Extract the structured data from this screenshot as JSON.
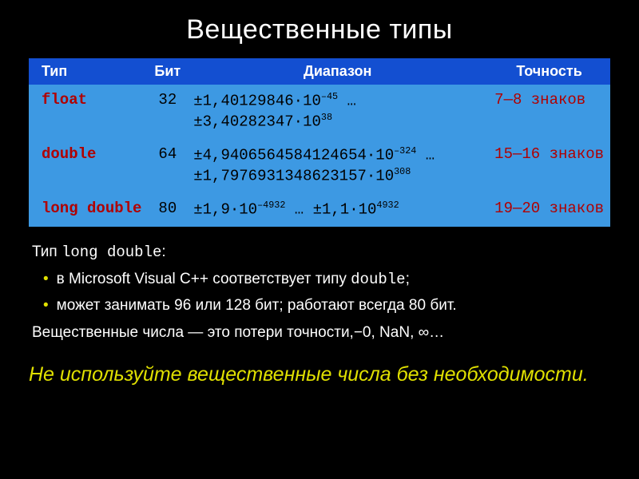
{
  "title": "Вещественные типы",
  "table": {
    "headers": [
      "Тип",
      "Бит",
      "Диапазон",
      "Точность"
    ],
    "rows": [
      {
        "type": "float",
        "bits": "32",
        "range_html": "±1,40129846·10<span class='sup'>–45</span> … ±3,40282347·10<span class='sup'>38</span>",
        "precision": "7—8 знаков"
      },
      {
        "type": "double",
        "bits": "64",
        "range_html": "±4,9406564584124654·10<span class='sup'>–324</span> … ±1,7976931348623157·10<span class='sup'>308</span>",
        "precision": "15—16 знаков"
      },
      {
        "type": "long double",
        "bits": "80",
        "range_html": "±1,9·10<span class='sup'>–4932</span> … ±1,1·10<span class='sup'>4932</span>",
        "precision": "19—20 знаков"
      }
    ]
  },
  "lead_html": "Тип <span class='mono'>long double</span>:",
  "bullets_html": [
    "в Microsoft Visual С++ соответствует типу <span class='mono'>double</span>;",
    "может занимать 96 или 128 бит; работают всегда 80 бит."
  ],
  "tail": "Вещественные числа — это потери точности,−0, NaN, ∞…",
  "highlight": "Не используйте вещественные числа без необходимости.",
  "chart_data": {
    "type": "table",
    "title": "Вещественные типы",
    "columns": [
      "Тип",
      "Бит",
      "Диапазон",
      "Точность"
    ],
    "rows": [
      [
        "float",
        32,
        "±1.40129846·10^-45 … ±3.40282347·10^38",
        "7—8 знаков"
      ],
      [
        "double",
        64,
        "±4.9406564584124654·10^-324 … ±1.7976931348623157·10^308",
        "15—16 знаков"
      ],
      [
        "long double",
        80,
        "±1.9·10^-4932 … ±1.1·10^4932",
        "19—20 знаков"
      ]
    ]
  }
}
